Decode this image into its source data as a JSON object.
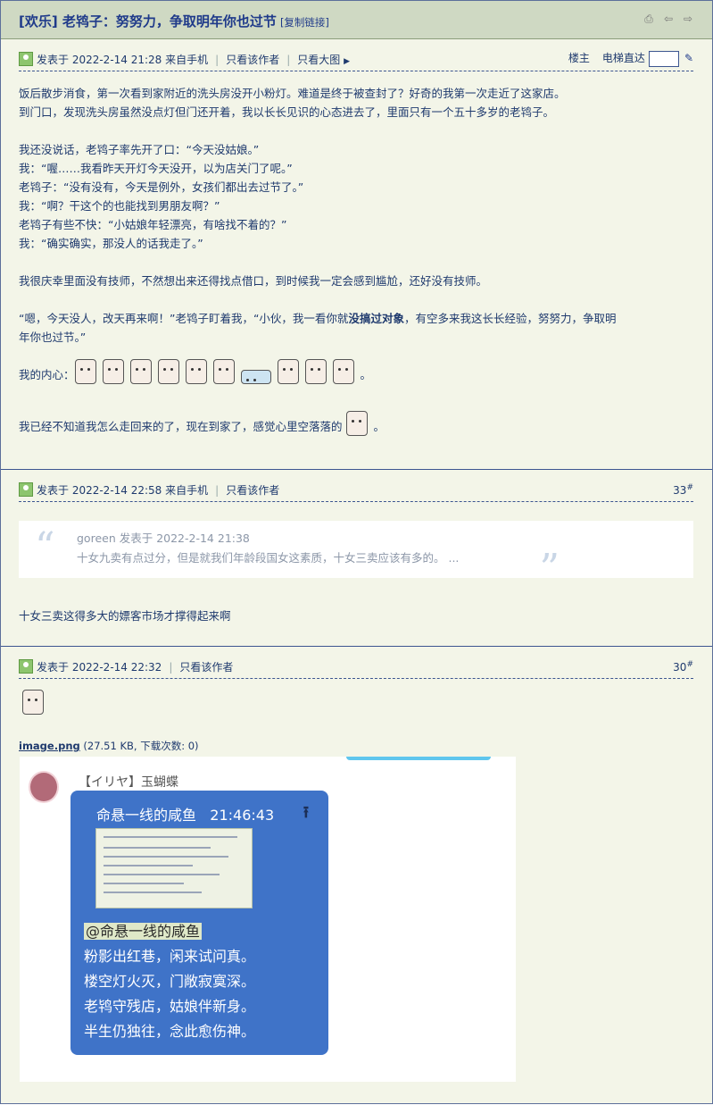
{
  "thread": {
    "title": "[欢乐] 老鸨子：努努力，争取明年你也过节",
    "copy_link": "[复制链接]"
  },
  "post1": {
    "posted": "发表于 2022-2-14 21:28 来自手机",
    "only_author": "只看该作者",
    "big_image": "只看大图",
    "floor_owner": "楼主",
    "elevator": "电梯直达",
    "lines": [
      "饭后散步消食，第一次看到家附近的洗头房没开小粉灯。难道是终于被查封了？好奇的我第一次走近了这家店。",
      "到门口，发现洗头房虽然没点灯但门还开着，我以长长见识的心态进去了，里面只有一个五十多岁的老鸨子。",
      "",
      "我还没说话，老鸨子率先开了口：“今天没姑娘。”",
      "我：“喔……我看昨天开灯今天没开，以为店关门了呢。”",
      "老鸨子：“没有没有，今天是例外，女孩们都出去过节了。”",
      "我：“啊？干这个的也能找到男朋友啊？”",
      "老鸨子有些不快：“小姑娘年轻漂亮，有啥找不着的？”",
      "我：“确实确实，那没人的话我走了。”",
      "",
      "我很庆幸里面没有技师，不然想出来还得找点借口，到时候我一定会感到尴尬，还好没有技师。"
    ],
    "para_a": "“嗯，今天没人，改天再来啊！”老鸨子盯着我，“小伙，我一看你就",
    "para_bold": "没搞过对象",
    "para_b": "，有空多来我这长长经验，努努力，争取明",
    "para_c": "年你也过节。”",
    "inner_label": "我的内心：",
    "closing": "我已经不知道我怎么走回来的了，现在到家了，感觉心里空落落的"
  },
  "post2": {
    "posted": "发表于 2022-2-14 22:58 来自手机",
    "only_author": "只看该作者",
    "floor": "33",
    "quote_author": "goreen 发表于 2022-2-14 21:38",
    "quote_text": "十女九卖有点过分，但是就我们年龄段国女这素质，十女三卖应该有多的。 ...",
    "reply": "十女三卖这得多大的嫖客市场才撑得起来啊"
  },
  "post3": {
    "posted": "发表于 2022-2-14 22:32",
    "only_author": "只看该作者",
    "floor": "30",
    "attach_name": "image.png",
    "attach_meta": "(27.51 KB, 下载次数: 0)",
    "chat_user": "【イリヤ】玉蝴蝶",
    "chat_sender": "命悬一线的咸鱼",
    "chat_time": "21:46:43",
    "mention": "@命悬一线的咸鱼",
    "poem": [
      "粉影出红巷，闲来试问真。",
      "楼空灯火灭，门敞寂寞深。",
      "老鸨守残店，姑娘伴新身。",
      "半生仍独往，念此愈伤神。"
    ]
  },
  "colors": {
    "accent": "#1f3a8a",
    "background": "#f3f5e8",
    "bubble": "#3f73c8"
  }
}
